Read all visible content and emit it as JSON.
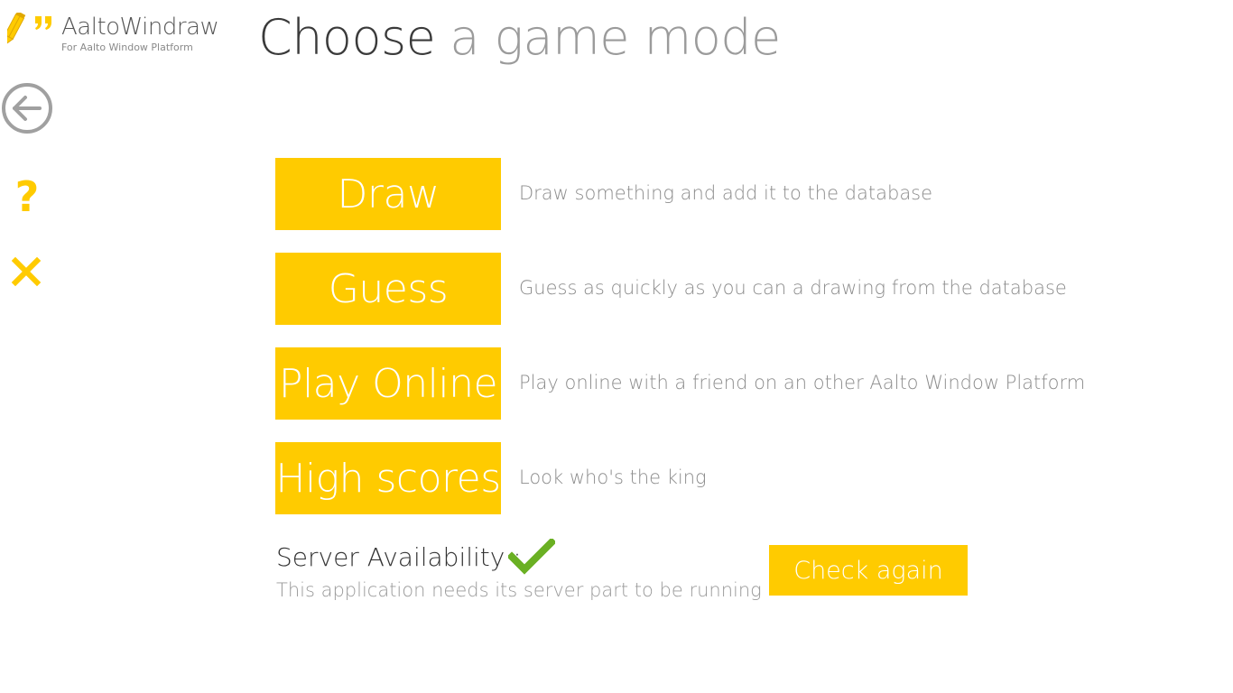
{
  "logo": {
    "title": "AaltoWindraw",
    "subtitle": "For Aalto Window Platform",
    "icon": "pencil-quote-icon"
  },
  "heading": {
    "strong": "Choose",
    "light": "a game mode"
  },
  "nav": {
    "back_icon": "back-arrow-icon",
    "help_symbol": "?",
    "close_icon": "close-icon"
  },
  "modes": [
    {
      "label": "Draw",
      "description": "Draw something and add it to the database"
    },
    {
      "label": "Guess",
      "description": "Guess as quickly as you can a drawing from the database"
    },
    {
      "label": "Play Online",
      "description": "Play online with a friend on an other Aalto Window Platform"
    },
    {
      "label": "High scores",
      "description": "Look who's the king"
    }
  ],
  "server": {
    "label": "Server Availability :",
    "status_icon": "checkmark-icon",
    "status": "available",
    "note": "This application needs its server part to be running",
    "check_again_label": "Check again"
  },
  "colors": {
    "accent": "#ffcb00",
    "status_ok": "#6ab023",
    "heading_dark": "#3a3a3a",
    "heading_light": "#9b9b9b",
    "nav_gray": "#a0a0a0"
  }
}
